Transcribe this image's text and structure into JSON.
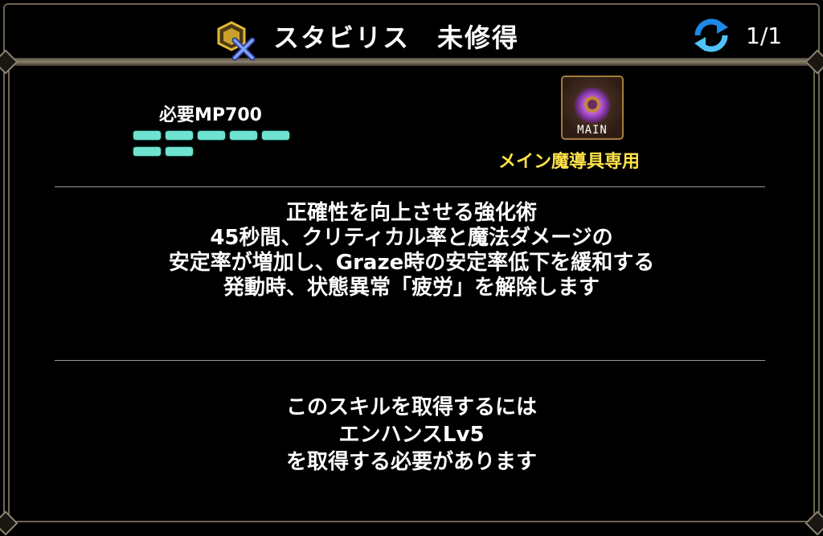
{
  "header": {
    "title": "スタビリス　未修得",
    "skill_icon": "skill-stabilis-icon",
    "refresh_icon": "refresh-icon",
    "page_indicator": "1/1"
  },
  "skill": {
    "mp_label": "必要MP700",
    "mp_gauge_segments": 7,
    "gauge_color": "#6fe3cf",
    "tool_badge": "MAIN",
    "tool_caption": "メイン魔導具専用",
    "tool_caption_color": "#ffe34a",
    "tool_icon": "main-magic-tool-ring-icon"
  },
  "description": {
    "lines": [
      "正確性を向上させる強化術",
      "45秒間、クリティカル率と魔法ダメージの",
      "安定率が増加し、Graze時の安定率低下を緩和する",
      "発動時、状態異常「疲労」を解除します"
    ]
  },
  "requirement": {
    "lines": [
      "このスキルを取得するには",
      "エンハンスLv5",
      "を取得する必要があります"
    ]
  }
}
